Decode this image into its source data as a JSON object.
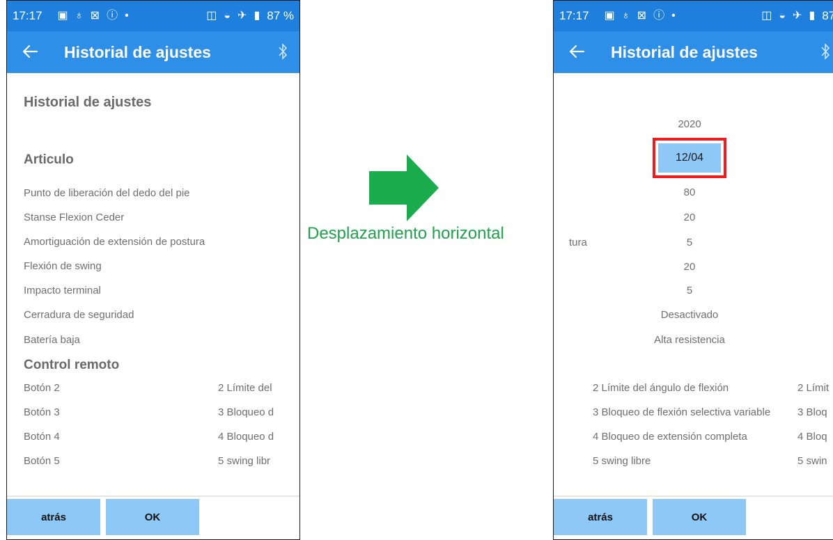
{
  "status": {
    "time": "17:17",
    "battery": "87 %",
    "battery_cut": "87 %"
  },
  "left": {
    "appbar_title": "Historial de ajustes",
    "page_title": "Historial de ajustes",
    "section_articulo": "Articulo",
    "items": [
      "Punto de liberación del dedo del pie",
      "Stanse Flexion Ceder",
      "Amortiguación de extensión de postura",
      "Flexión de swing",
      "Impacto terminal",
      "Cerradura de seguridad",
      "Batería baja"
    ],
    "section_control": "Control remoto",
    "remote_rows": [
      {
        "label": "Botón 2",
        "value": "2 Límite del"
      },
      {
        "label": "Botón 3",
        "value": "3 Bloqueo d"
      },
      {
        "label": "Botón 4",
        "value": "4 Bloqueo d"
      },
      {
        "label": "Botón 5",
        "value": "5 swing libr"
      }
    ],
    "btn_back": "atrás",
    "btn_ok": "OK"
  },
  "middle": {
    "caption": "Desplazamiento horizontal",
    "arrow_color": "#1aac4c"
  },
  "right": {
    "appbar_title": "Historial de ajustes",
    "year": "2020",
    "date": "12/04",
    "partial_label": "tura",
    "values": [
      "80",
      "20",
      "5",
      "20",
      "5",
      "Desactivado",
      "Alta resistencia"
    ],
    "remote_rows": [
      {
        "value": "2 Límite del ángulo de flexión",
        "next": "2 Límit"
      },
      {
        "value": "3 Bloqueo de flexión selectiva variable",
        "next": "3 Bloq"
      },
      {
        "value": "4 Bloqueo de extensión completa",
        "next": "4 Bloq"
      },
      {
        "value": "5 swing libre",
        "next": "5 swin"
      }
    ],
    "btn_back": "atrás",
    "btn_ok": "OK"
  },
  "colors": {
    "statusbar": "#1f7fdc",
    "appbar": "#2e8fe8",
    "button": "#8ec8f6",
    "highlight_border": "#ee1c1c"
  }
}
